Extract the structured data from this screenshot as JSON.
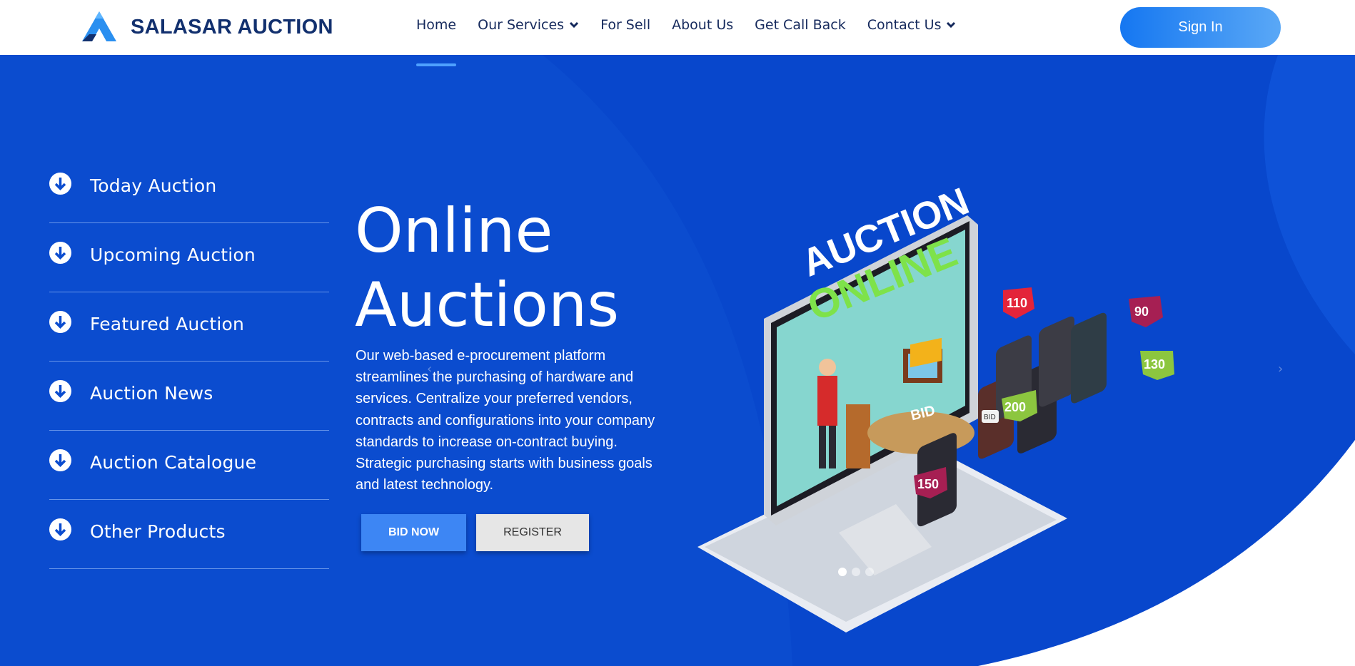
{
  "brand": {
    "name": "SALASAR AUCTION"
  },
  "nav": {
    "items": [
      {
        "label": "Home",
        "dropdown": false,
        "active": true
      },
      {
        "label": "Our Services",
        "dropdown": true
      },
      {
        "label": "For Sell",
        "dropdown": false
      },
      {
        "label": "About Us",
        "dropdown": false
      },
      {
        "label": "Get Call Back",
        "dropdown": false
      },
      {
        "label": "Contact Us",
        "dropdown": true
      }
    ],
    "signin_label": "Sign In"
  },
  "sidebar": {
    "items": [
      {
        "label": "Today Auction",
        "icon": "arrow-down-circle-icon"
      },
      {
        "label": "Upcoming Auction",
        "icon": "arrow-down-circle-icon"
      },
      {
        "label": "Featured Auction",
        "icon": "arrow-down-circle-icon"
      },
      {
        "label": "Auction News",
        "icon": "arrow-down-circle-icon"
      },
      {
        "label": "Auction Catalogue",
        "icon": "arrow-down-circle-icon"
      },
      {
        "label": "Other Products",
        "icon": "arrow-down-circle-icon"
      }
    ]
  },
  "hero": {
    "title_line1": "Online",
    "title_line2": "Auctions",
    "description": "Our web-based e-procurement platform streamlines the purchasing of hardware and services. Centralize your preferred vendors, contracts and configurations into your company standards to increase on-contract buying. Strategic purchasing starts with business goals and latest technology.",
    "bid_button": "BID NOW",
    "register_button": "REGISTER",
    "prev_arrow": "‹",
    "next_arrow": "›",
    "slides": 3,
    "active_slide": 1
  },
  "illustration": {
    "headline_top": "AUCTION",
    "headline_bottom": "ONLINE",
    "sign_label": "BID",
    "bubbles": [
      "110",
      "90",
      "130",
      "200",
      "150"
    ],
    "phone_tag": "BID"
  },
  "colors": {
    "brand_dark": "#12306e",
    "hero_blue": "#0a4bd0",
    "accent_blue": "#3d86f4",
    "signin_gradient_start": "#1577f1",
    "signin_gradient_end": "#5aa8f6",
    "auction_green": "#7ee24a"
  }
}
